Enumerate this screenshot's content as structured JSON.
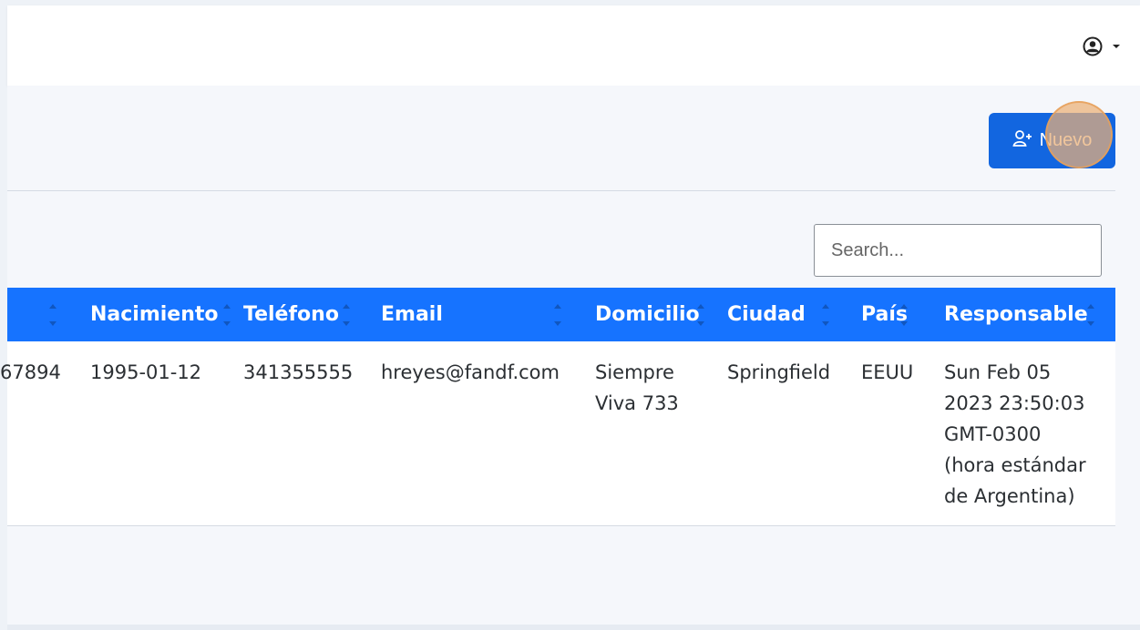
{
  "header": {
    "user_icon": "user-circle-icon",
    "dropdown_icon": "caret-down-icon"
  },
  "toolbar": {
    "new_button_label": "Nuevo",
    "new_button_icon": "user-plus-icon",
    "accent_color": "#1266e0"
  },
  "search": {
    "placeholder": "Search...",
    "value": ""
  },
  "table": {
    "header_color": "#1673ff",
    "columns": [
      "",
      "Nacimiento",
      "Teléfono",
      "Email",
      "Domicilio",
      "Ciudad",
      "País",
      "Responsable"
    ],
    "rows": [
      {
        "partial_id": "67894",
        "nacimiento": "1995-01-12",
        "telefono": "341355555",
        "email": "hreyes@fandf.com",
        "domicilio": [
          "Siempre",
          "Viva 733"
        ],
        "ciudad": "Springfield",
        "pais": "EEUU",
        "responsable": [
          "Sun Feb 05",
          "2023 23:50:03",
          "GMT-0300",
          "(hora estándar",
          "de Argentina)"
        ]
      }
    ]
  }
}
